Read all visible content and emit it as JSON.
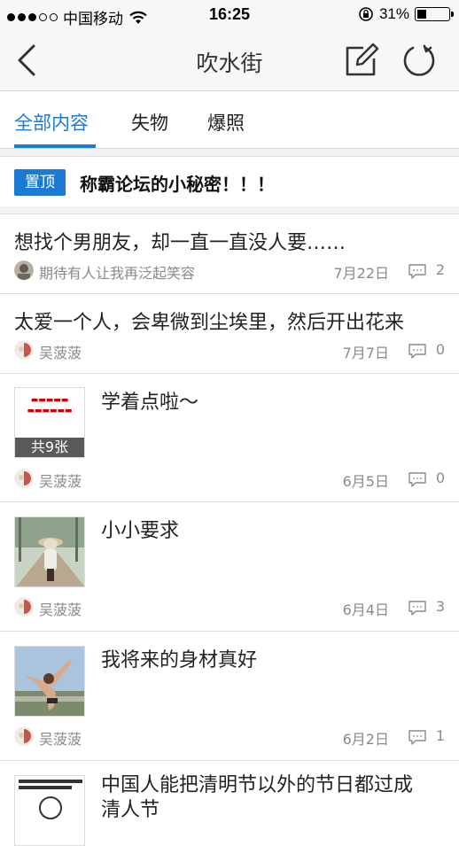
{
  "status_bar": {
    "carrier": "中国移动",
    "time": "16:25",
    "battery_percent": "31%",
    "battery_level": 0.31
  },
  "nav": {
    "title": "吹水街",
    "back_icon": "chevron-left-icon",
    "compose_icon": "compose-icon",
    "refresh_icon": "refresh-icon"
  },
  "tabs": [
    {
      "label": "全部内容",
      "active": true
    },
    {
      "label": "失物",
      "active": false
    },
    {
      "label": "爆照",
      "active": false
    }
  ],
  "pinned": {
    "badge": "置顶",
    "title": "称霸论坛的小秘密！！！"
  },
  "posts": [
    {
      "title": "想找个男朋友，却一直一直没人要……",
      "author": "期待有人让我再泛起笑容",
      "date": "7月22日",
      "comments": "2"
    },
    {
      "title": "太爱一个人，会卑微到尘埃里，然后开出花来",
      "author": "吴菠菠",
      "date": "7月7日",
      "comments": "0"
    },
    {
      "title": "学着点啦～",
      "author": "吴菠菠",
      "date": "6月5日",
      "comments": "0",
      "image_count": "共9张"
    },
    {
      "title": "小小要求",
      "author": "吴菠菠",
      "date": "6月4日",
      "comments": "3"
    },
    {
      "title": "我将来的身材真好",
      "author": "吴菠菠",
      "date": "6月2日",
      "comments": "1"
    },
    {
      "title": "中国人能把清明节以外的节日都过成清人节",
      "title_line1": "中国人能把清明节以外的节日都过成",
      "title_line2": "清人节"
    }
  ],
  "colors": {
    "accent": "#1b7ad4",
    "muted_text": "#8a8a8a",
    "bar_bg": "#f7f7f7"
  }
}
